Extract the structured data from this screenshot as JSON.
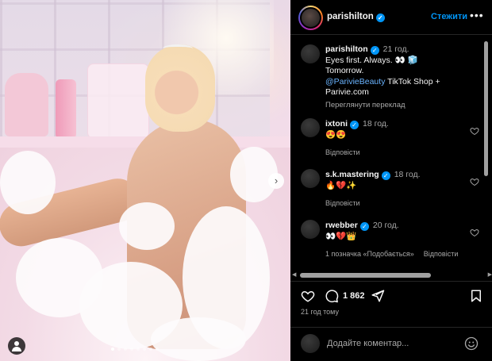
{
  "post": {
    "image_alt": "",
    "dots_count": 8,
    "active_dot": 0
  },
  "header": {
    "username": "parishilton",
    "verified": true,
    "follow_label": "Стежити",
    "more_icon": "ellipsis-icon"
  },
  "caption": {
    "username": "parishilton",
    "time": "21 год.",
    "line1": "Eyes first. Always. 👀 🧊",
    "line2": "Tomorrow.",
    "mention": "@ParivieBeauty",
    "line3_rest": " TikTok Shop +",
    "line4": "Parivie.com",
    "translate_label": "Переглянути переклад"
  },
  "comments": [
    {
      "username": "ixtoni",
      "verified": true,
      "time": "18 год.",
      "text": "😍😍",
      "reply_label": "Відповісти",
      "likes": ""
    },
    {
      "username": "s.k.mastering",
      "verified": true,
      "time": "18 год.",
      "text": "🔥💔✨",
      "reply_label": "Відповісти",
      "likes": ""
    },
    {
      "username": "rwebber",
      "verified": true,
      "time": "20 год.",
      "text": "👀💔👑",
      "reply_label": "Відповісти",
      "likes": "1 позначка «Подобається»"
    }
  ],
  "actions": {
    "comment_count": "1 862",
    "posted_ago": "21 год тому"
  },
  "add_comment": {
    "placeholder": "Додайте коментар..."
  },
  "colors": {
    "accent": "#0095f6",
    "background": "#000000",
    "muted": "#a8a8a8"
  }
}
